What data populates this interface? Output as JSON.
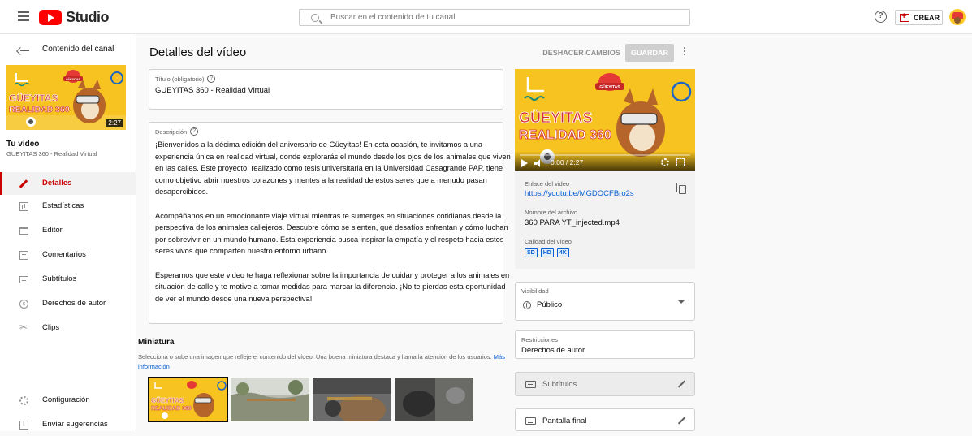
{
  "header": {
    "logo_text": "Studio",
    "search_placeholder": "Buscar en el contenido de tu canal",
    "help_glyph": "?",
    "create_label": "CREAR"
  },
  "sidebar": {
    "back_label": "Contenido del canal",
    "video_duration": "2:27",
    "your_video_label": "Tu video",
    "your_video_title": "GUEYITAS 360 - Realidad Virtual",
    "items": [
      {
        "label": "Detalles",
        "icon": "pencil-icon",
        "active": true
      },
      {
        "label": "Estadísticas",
        "icon": "analytics-icon",
        "active": false
      },
      {
        "label": "Editor",
        "icon": "editor-icon",
        "active": false
      },
      {
        "label": "Comentarios",
        "icon": "comments-icon",
        "active": false
      },
      {
        "label": "Subtítulos",
        "icon": "subtitles-icon",
        "active": false
      },
      {
        "label": "Derechos de autor",
        "icon": "copyright-icon",
        "active": false
      },
      {
        "label": "Clips",
        "icon": "scissors-icon",
        "active": false
      }
    ],
    "bottom_items": [
      {
        "label": "Configuración",
        "icon": "gear-icon"
      },
      {
        "label": "Enviar sugerencias",
        "icon": "feedback-icon"
      }
    ]
  },
  "main": {
    "page_title": "Detalles del vídeo",
    "undo_label": "DESHACER CAMBIOS",
    "save_label": "GUARDAR",
    "title_field": {
      "label": "Título (obligatorio)",
      "value": "GUEYITAS 360 - Realidad Virtual"
    },
    "description_field": {
      "label": "Descripción",
      "paragraphs": [
        "¡Bienvenidos a la décima edición del aniversario de Güeyitas! En esta ocasión, te invitamos a una experiencia única en realidad virtual, donde explorarás el mundo desde los ojos de los animales que viven en las calles. Este proyecto, realizado como tesis universitaria en la Universidad Casagrande PAP, tiene como objetivo abrir nuestros corazones y mentes a la realidad de estos seres que a menudo pasan desapercibidos.",
        "Acompáñanos en un emocionante viaje virtual mientras te sumerges en situaciones cotidianas desde la perspectiva de los animales callejeros. Descubre cómo se sienten, qué desafíos enfrentan y cómo luchan por sobrevivir en un mundo humano. Esta experiencia busca inspirar la empatía y el respeto hacia estos seres vivos que comparten nuestro entorno urbano.",
        "Esperamos que este video te haga reflexionar sobre la importancia de cuidar y proteger a los animales en situación de calle y te motive a tomar medidas para marcar la diferencia. ¡No te pierdas esta oportunidad de ver el mundo desde una nueva perspectiva!"
      ]
    },
    "thumbnail_section": {
      "title": "Miniatura",
      "subtitle": "Selecciona o sube una imagen que refleje el contenido del vídeo. Una buena miniatura destaca y llama la atención de los usuarios.",
      "more_link": "Más información"
    }
  },
  "thumbnail_art": {
    "line1": "GÜEYITAS",
    "line2": "REALIDAD 360",
    "badge": "GÜEYITAS"
  },
  "video_card": {
    "time": "0:00 / 2:27",
    "link_label": "Enlace del video",
    "link_value": "https://youtu.be/MGDOCFBro2s",
    "filename_label": "Nombre del archivo",
    "filename_value": "360 PARA YT_injected.mp4",
    "quality_label": "Calidad del vídeo",
    "quality_badges": [
      "SD",
      "HD",
      "4K"
    ]
  },
  "visibility": {
    "label": "Visibilidad",
    "value": "Público"
  },
  "restrictions": {
    "label": "Restricciones",
    "value": "Derechos de autor"
  },
  "cards": {
    "subtitles_label": "Subtítulos",
    "end_screen_label": "Pantalla final"
  },
  "colors": {
    "brand_red": "#ff0000",
    "accent_red": "#cc0000",
    "link_blue": "#065fd4",
    "thumb_yellow": "#f6c320"
  }
}
